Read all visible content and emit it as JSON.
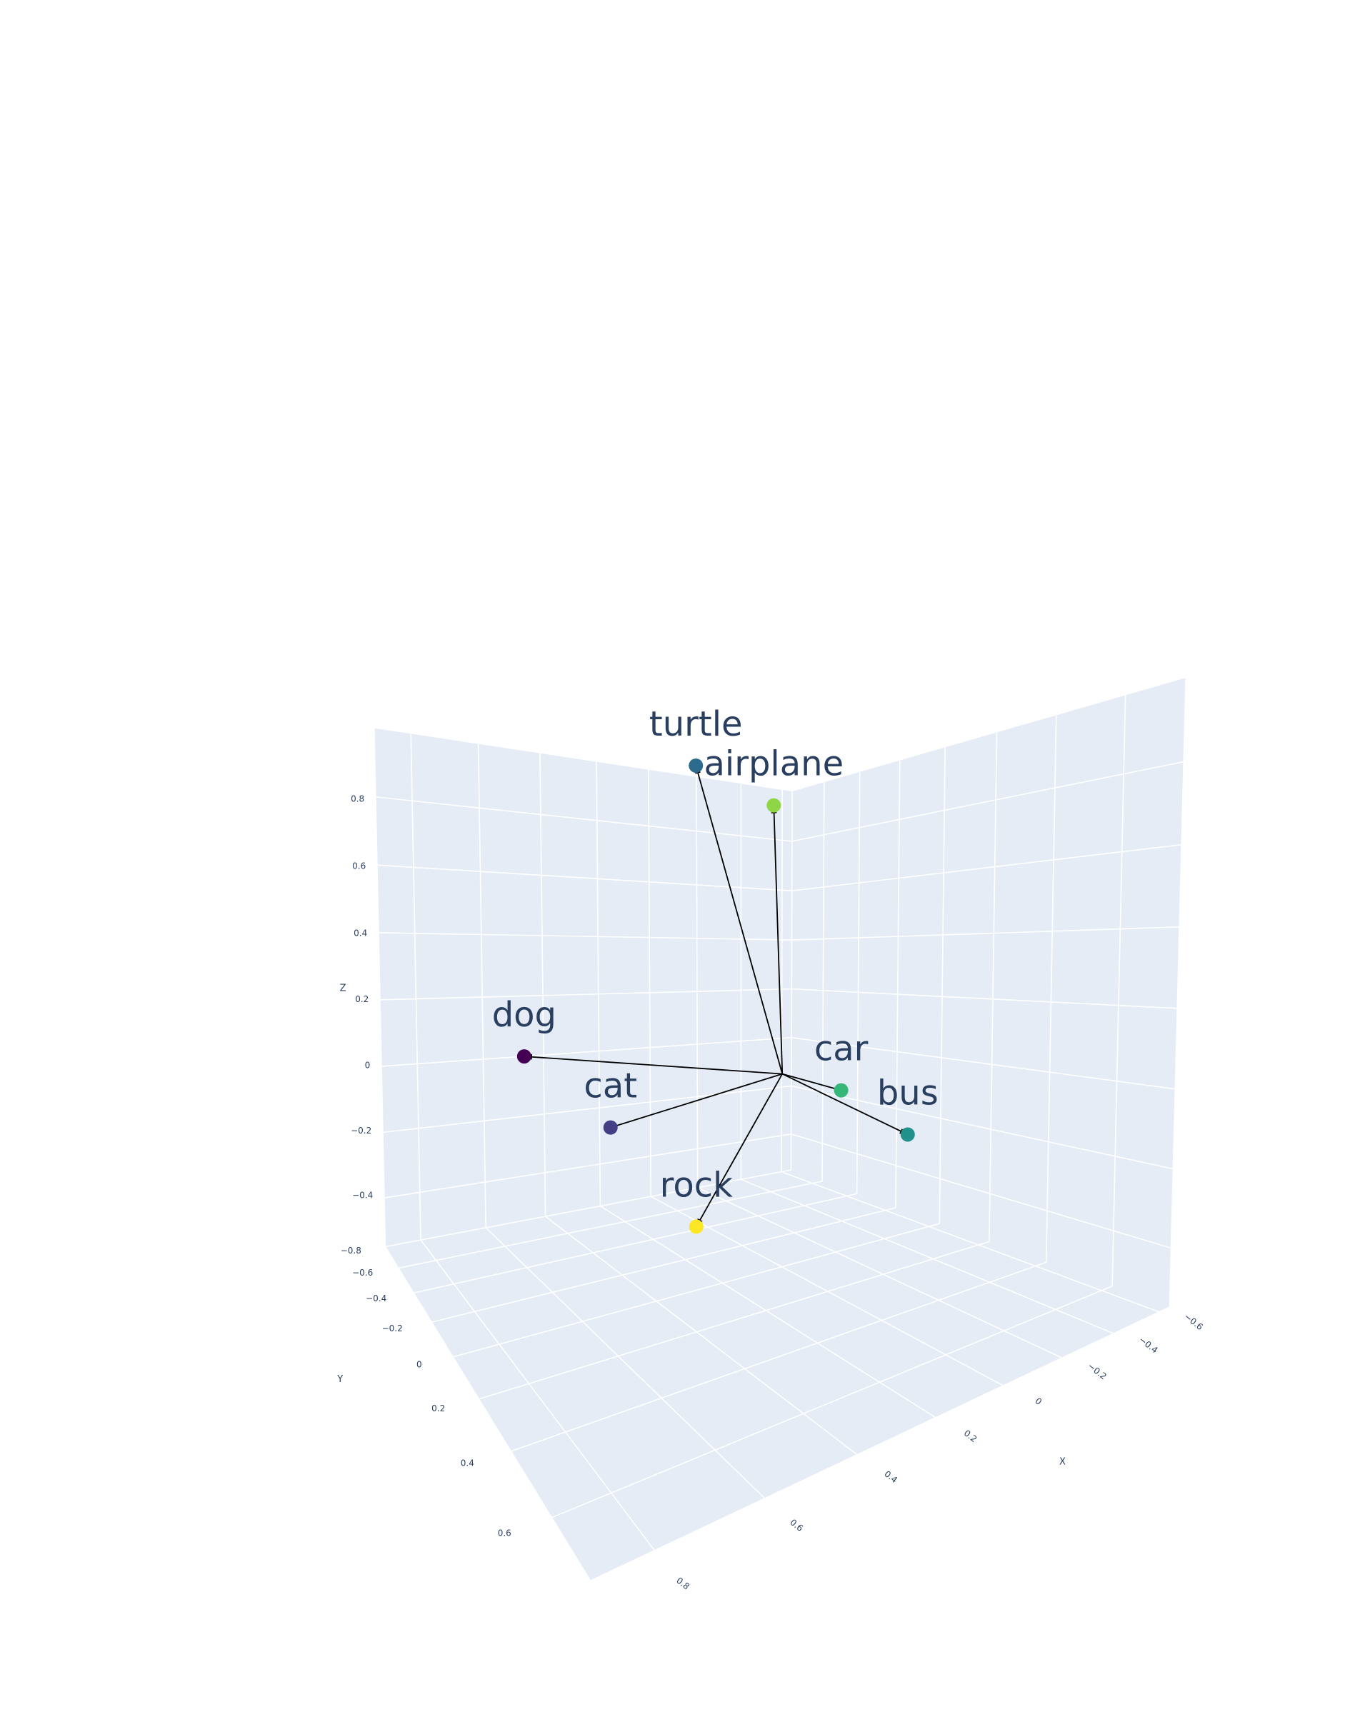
{
  "chart_data": {
    "type": "scatter",
    "dimensions": 3,
    "grid": true,
    "legend": "none",
    "background_color": "#e5ecf6",
    "gridline_color": "#ffffff",
    "vector_color": "#000000",
    "axes": {
      "x": {
        "title": "X",
        "range": [
          -0.65,
          0.9
        ],
        "ticks": [
          -0.6,
          -0.4,
          -0.2,
          0,
          0.2,
          0.4,
          0.6,
          0.8
        ],
        "tick_labels": [
          "−0.6",
          "−0.4",
          "−0.2",
          "0",
          "0.2",
          "0.4",
          "0.6",
          "0.8"
        ]
      },
      "y": {
        "title": "Y",
        "range": [
          -0.8,
          0.75
        ],
        "ticks": [
          -0.8,
          -0.6,
          -0.4,
          -0.2,
          0,
          0.2,
          0.4,
          0.6
        ],
        "tick_labels": [
          "−0.8",
          "−0.6",
          "−0.4",
          "−0.2",
          "0",
          "0.2",
          "0.4",
          "0.6"
        ]
      },
      "z": {
        "title": "Z",
        "range": [
          -0.55,
          1.0
        ],
        "ticks": [
          -0.4,
          -0.2,
          0,
          0.2,
          0.4,
          0.6,
          0.8
        ],
        "tick_labels": [
          "−0.4",
          "−0.2",
          "0",
          "0.2",
          "0.4",
          "0.6",
          "0.8"
        ]
      }
    },
    "origin": [
      0,
      0,
      0
    ],
    "points": [
      {
        "label": "turtle",
        "x": 0.1,
        "y": -0.3,
        "z": 0.9,
        "color": "#2c6b8e",
        "arrow": true
      },
      {
        "label": "airplane",
        "x": -0.3,
        "y": -0.45,
        "z": 0.85,
        "color": "#8ed645",
        "arrow": true
      },
      {
        "label": "dog",
        "x": 0.6,
        "y": -0.4,
        "z": 0.05,
        "color": "#440154",
        "arrow": true
      },
      {
        "label": "cat",
        "x": 0.5,
        "y": -0.05,
        "z": -0.1,
        "color": "#433e85",
        "arrow": false
      },
      {
        "label": "rock",
        "x": 0.4,
        "y": 0.2,
        "z": -0.3,
        "color": "#fde725",
        "arrow": true
      },
      {
        "label": "car",
        "x": -0.35,
        "y": -0.15,
        "z": -0.1,
        "color": "#35b779",
        "arrow": false
      },
      {
        "label": "bus",
        "x": -0.55,
        "y": -0.05,
        "z": -0.25,
        "color": "#21918c",
        "arrow": true
      }
    ]
  }
}
